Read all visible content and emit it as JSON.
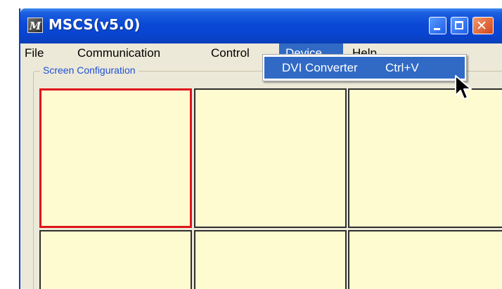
{
  "window": {
    "title": "MSCS(v5.0)",
    "icon": "app-logo-icon",
    "icon_text": "M",
    "controls": [
      "minimize-icon",
      "maximize-icon",
      "close-icon"
    ]
  },
  "menubar": {
    "items": [
      {
        "label": "File"
      },
      {
        "label": "Communication"
      },
      {
        "label": "Control"
      },
      {
        "label": "Device",
        "active": true
      },
      {
        "label": "Help"
      }
    ]
  },
  "dropdown": {
    "item_label": "DVI Converter",
    "item_shortcut": "Ctrl+V"
  },
  "screen_config": {
    "label": "Screen Configuration",
    "cells": [
      {
        "row": 1,
        "col": 1,
        "selected": true
      },
      {
        "row": 1,
        "col": 2,
        "selected": false
      },
      {
        "row": 1,
        "col": 3,
        "selected": false
      },
      {
        "row": 2,
        "col": 1,
        "selected": false
      },
      {
        "row": 2,
        "col": 2,
        "selected": false
      },
      {
        "row": 2,
        "col": 3,
        "selected": false
      }
    ]
  },
  "colors": {
    "titlebar": "#0a49d6",
    "menu_highlight": "#316ac5",
    "cell_fill": "#fffbd0",
    "selected_border": "#e0141a",
    "group_label": "#1f4fd6"
  }
}
